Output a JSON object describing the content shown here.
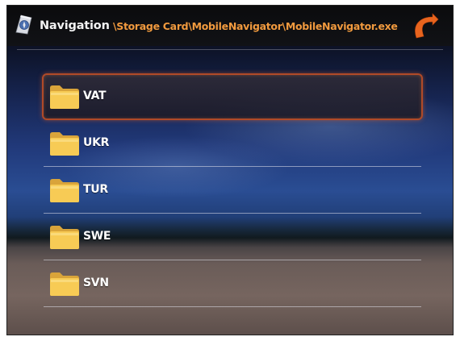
{
  "header": {
    "title": "Navigation",
    "path": "\\Storage Card\\MobileNavigator\\MobileNavigator.exe",
    "back_icon": "back-arrow-icon",
    "app_icon": "navigation-app-icon"
  },
  "folders": [
    {
      "label": "VAT",
      "selected": true
    },
    {
      "label": "UKR",
      "selected": false
    },
    {
      "label": "TUR",
      "selected": false
    },
    {
      "label": "SWE",
      "selected": false
    },
    {
      "label": "SVN",
      "selected": false
    }
  ],
  "colors": {
    "path": "#f19a3e",
    "accent": "#e8641e",
    "selection_border": "#b04a28",
    "folder": "#f7cb55"
  }
}
